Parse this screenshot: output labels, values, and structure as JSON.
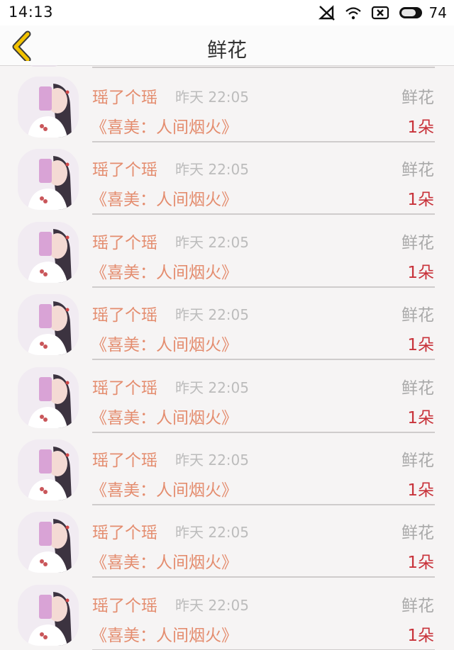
{
  "status": {
    "time": "14:13",
    "battery_level": "74",
    "icons": [
      "no-sim-icon",
      "wifi-icon",
      "close-box-icon",
      "battery-icon"
    ]
  },
  "nav": {
    "back_icon": "chevron-left-icon",
    "title": "鲜花",
    "accent": "#f2c200"
  },
  "colors": {
    "name": "#e48d6f",
    "count": "#c8323a",
    "muted": "#a9a9a9"
  },
  "items": [
    {
      "user": "瑶了个瑶",
      "time": "昨天 22:05",
      "gift_type": "鲜花",
      "song": "《喜美：人间烟火》",
      "count": "1朵"
    },
    {
      "user": "瑶了个瑶",
      "time": "昨天 22:05",
      "gift_type": "鲜花",
      "song": "《喜美：人间烟火》",
      "count": "1朵"
    },
    {
      "user": "瑶了个瑶",
      "time": "昨天 22:05",
      "gift_type": "鲜花",
      "song": "《喜美：人间烟火》",
      "count": "1朵"
    },
    {
      "user": "瑶了个瑶",
      "time": "昨天 22:05",
      "gift_type": "鲜花",
      "song": "《喜美：人间烟火》",
      "count": "1朵"
    },
    {
      "user": "瑶了个瑶",
      "time": "昨天 22:05",
      "gift_type": "鲜花",
      "song": "《喜美：人间烟火》",
      "count": "1朵"
    },
    {
      "user": "瑶了个瑶",
      "time": "昨天 22:05",
      "gift_type": "鲜花",
      "song": "《喜美：人间烟火》",
      "count": "1朵"
    },
    {
      "user": "瑶了个瑶",
      "time": "昨天 22:05",
      "gift_type": "鲜花",
      "song": "《喜美：人间烟火》",
      "count": "1朵"
    },
    {
      "user": "瑶了个瑶",
      "time": "昨天 22:05",
      "gift_type": "鲜花",
      "song": "《喜美：人间烟火》",
      "count": "1朵"
    }
  ]
}
